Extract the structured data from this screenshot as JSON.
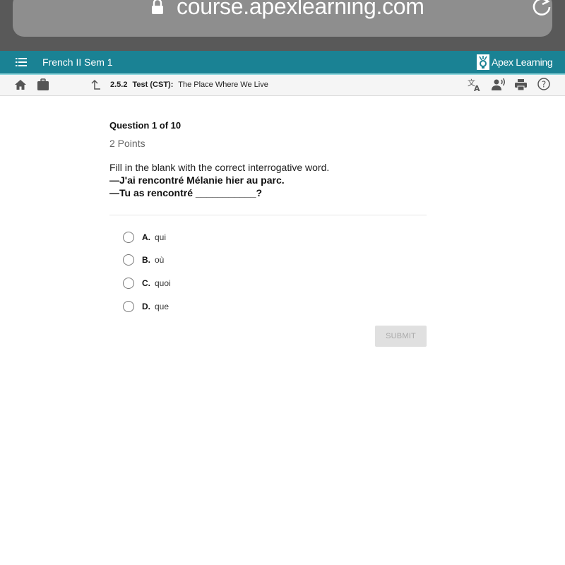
{
  "browser": {
    "url": "course.apexlearning.com",
    "lock_icon": "lock-icon",
    "reload_icon": "reload-icon"
  },
  "header": {
    "course_title": "French II Sem 1",
    "brand_name": "Apex Learning",
    "colors": {
      "header_bg": "#1a8294",
      "accent_line": "#8fd6dc"
    }
  },
  "toolbar": {
    "breadcrumb": {
      "section": "2.5.2",
      "activity": "Test (CST):",
      "title": "The Place Where We Live"
    },
    "left_icons": [
      "home-icon",
      "briefcase-icon",
      "up-arrow-icon"
    ],
    "right_icons": [
      "translate-icon",
      "read-aloud-icon",
      "print-icon",
      "help-icon"
    ]
  },
  "question": {
    "number_label": "Question 1 of 10",
    "points_label": "2 Points",
    "instruction": "Fill in the blank with the correct interrogative word.",
    "dialogue": [
      "—J'ai rencontré Mélanie hier au parc.",
      "—Tu as rencontré ___________?"
    ],
    "options": [
      {
        "letter": "A.",
        "text": "qui",
        "selected": false
      },
      {
        "letter": "B.",
        "text": "où",
        "selected": false
      },
      {
        "letter": "C.",
        "text": "quoi",
        "selected": false
      },
      {
        "letter": "D.",
        "text": "que",
        "selected": false
      }
    ],
    "submit_label": "SUBMIT",
    "submit_enabled": false
  }
}
